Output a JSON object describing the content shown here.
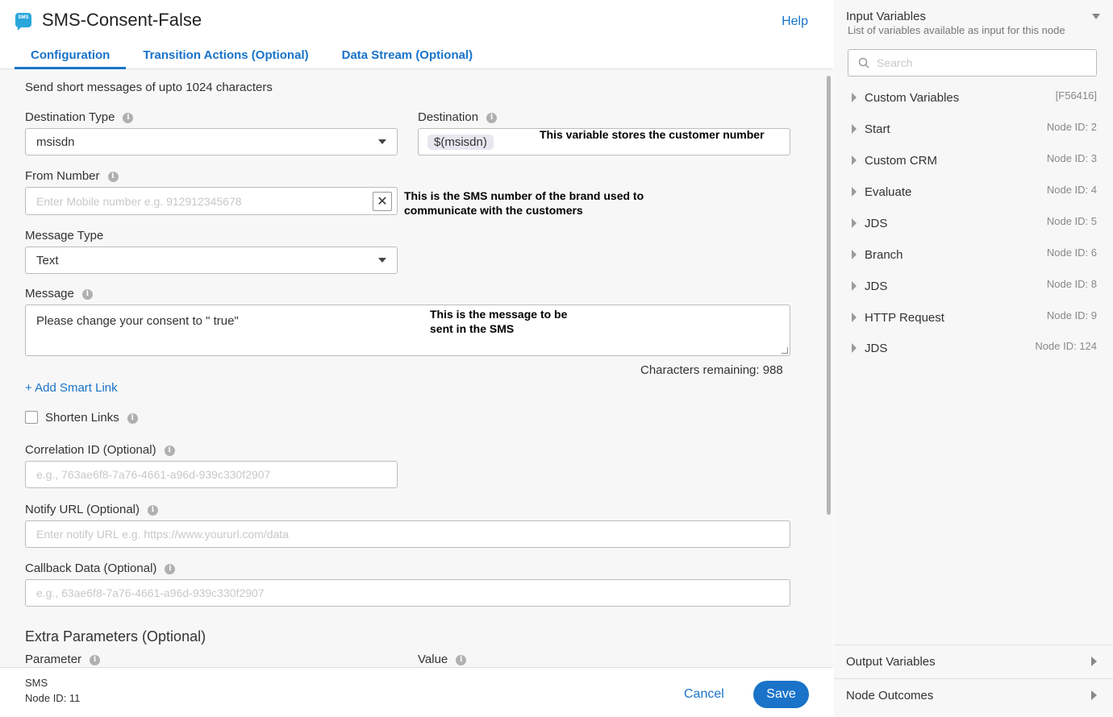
{
  "header": {
    "title": "SMS-Consent-False",
    "icon_text": "SMS",
    "help_label": "Help",
    "tabs": [
      {
        "label": "Configuration"
      },
      {
        "label": "Transition Actions (Optional)"
      },
      {
        "label": "Data Stream (Optional)"
      }
    ]
  },
  "form": {
    "description": "Send short messages of upto 1024 characters",
    "destination_type": {
      "label": "Destination Type",
      "value": "msisdn"
    },
    "destination": {
      "label": "Destination",
      "value": "$(msisdn)"
    },
    "from_number": {
      "label": "From Number",
      "placeholder": "Enter Mobile number e.g. 912912345678"
    },
    "message_type": {
      "label": "Message Type",
      "value": "Text"
    },
    "message": {
      "label": "Message",
      "value": "Please change your consent to \" true\""
    },
    "chars_remaining": "Characters remaining: 988",
    "add_smart_link": "+ Add Smart Link",
    "shorten_links": {
      "label": "Shorten Links",
      "checked": false
    },
    "correlation_id": {
      "label": "Correlation ID (Optional)",
      "placeholder": "e.g., 763ae6f8-7a76-4661-a96d-939c330f2907"
    },
    "notify_url": {
      "label": "Notify URL (Optional)",
      "placeholder": "Enter notify URL e.g. https://www.yoururl.com/data"
    },
    "callback_data": {
      "label": "Callback Data (Optional)",
      "placeholder": "e.g., 63ae6f8-7a76-4661-a96d-939c330f2907"
    },
    "extra_params": {
      "title": "Extra Parameters (Optional)",
      "parameter_label": "Parameter",
      "value_label": "Value"
    }
  },
  "annotations": {
    "destination_note": "This variable stores the customer number",
    "from_number_note": "This is the SMS number of the brand used to communicate with the customers",
    "message_note": "This is the message to be sent in the SMS"
  },
  "footer": {
    "node_type": "SMS",
    "node_id": "Node ID: 11",
    "cancel_label": "Cancel",
    "save_label": "Save"
  },
  "sidebar": {
    "title": "Input Variables",
    "subtitle": "List of variables available as input for this node",
    "search_placeholder": "Search",
    "variables": [
      {
        "name": "Custom Variables",
        "meta": "[F56416]"
      },
      {
        "name": "Start",
        "meta": "Node ID: 2"
      },
      {
        "name": "Custom CRM",
        "meta": "Node ID: 3"
      },
      {
        "name": "Evaluate",
        "meta": "Node ID: 4"
      },
      {
        "name": "JDS",
        "meta": "Node ID: 5"
      },
      {
        "name": "Branch",
        "meta": "Node ID: 6"
      },
      {
        "name": "JDS",
        "meta": "Node ID: 8"
      },
      {
        "name": "HTTP Request",
        "meta": "Node ID: 9"
      },
      {
        "name": "JDS",
        "meta": "Node ID: 124"
      }
    ],
    "output_variables_label": "Output Variables",
    "node_outcomes_label": "Node Outcomes"
  },
  "colors": {
    "accent": "#1a73c9",
    "sms_icon": "#2aa7dd",
    "panel_bg": "#f7f7f7"
  }
}
